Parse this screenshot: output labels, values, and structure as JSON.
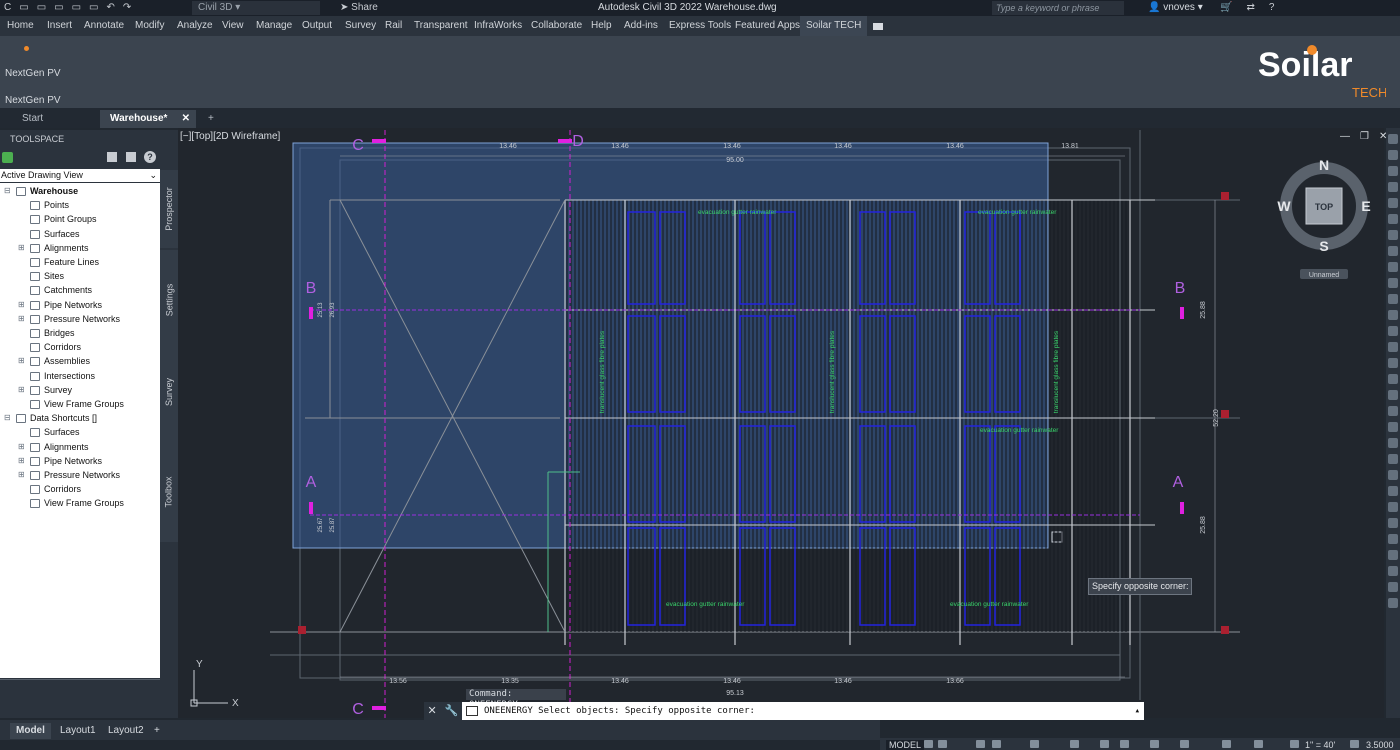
{
  "titlebar": {
    "workspace": "Civil 3D",
    "share": "Share",
    "title": "Autodesk Civil 3D 2022    Warehouse.dwg",
    "search_placeholder": "Type a keyword or phrase",
    "user": "vnoves"
  },
  "menu": [
    "Home",
    "Insert",
    "Annotate",
    "Modify",
    "Analyze",
    "View",
    "Manage",
    "Output",
    "Survey",
    "Rail",
    "Transparent",
    "InfraWorks",
    "Collaborate",
    "Help",
    "Add-ins",
    "Express Tools",
    "Featured Apps",
    "Soilar TECH"
  ],
  "ribbon": {
    "panel_button": "NextGen PV",
    "panel_title": "NextGen PV",
    "logo_main": "Soilar",
    "logo_sub": "TECH"
  },
  "doc_tabs": [
    "Start",
    "Warehouse*"
  ],
  "toolspace": {
    "title": "TOOLSPACE",
    "view_select": "Active Drawing View",
    "tree": [
      "Warehouse",
      "Points",
      "Point Groups",
      "Surfaces",
      "Alignments",
      "Feature Lines",
      "Sites",
      "Catchments",
      "Pipe Networks",
      "Pressure Networks",
      "Bridges",
      "Corridors",
      "Assemblies",
      "Intersections",
      "Survey",
      "View Frame Groups",
      "Data Shortcuts []",
      "Surfaces",
      "Alignments",
      "Pipe Networks",
      "Pressure Networks",
      "Corridors",
      "View Frame Groups"
    ],
    "side_tabs": [
      "Prospector",
      "Settings",
      "Survey",
      "Toolbox"
    ]
  },
  "viewport": {
    "label": "[−][Top][2D Wireframe]",
    "viewcube": {
      "top": "TOP",
      "n": "N",
      "s": "S",
      "e": "E",
      "w": "W",
      "ucs": "Unnamed"
    },
    "dims_top": [
      "13.46",
      "13.46",
      "13.46",
      "13.46",
      "13.46",
      "13.81",
      "95.00"
    ],
    "dims_bottom": [
      "13.56",
      "13.35",
      "13.46",
      "13.46",
      "13.46",
      "13.66",
      "95.13"
    ],
    "dims_right": [
      "25.88",
      "52.20",
      "25.88"
    ],
    "dims_left": [
      "25.13",
      "26.93",
      "25.67",
      "25.87"
    ],
    "grid_letters": [
      "C",
      "D",
      "B",
      "B",
      "A",
      "A",
      "C"
    ],
    "annotations": [
      "evacuation gutter rainwater",
      "evacuation gutter rainwater",
      "evacuation gutter rainwater",
      "evacuation gutter rainwater",
      "evacuation gutter rainwater",
      "translucent glass fibre plates",
      "translucent glass fibre plates",
      "translucent glass fibre plates"
    ],
    "tooltip": "Specify opposite corner:"
  },
  "command": {
    "history": "Command: ONEENERGY",
    "prompt": "ONEENERGY Select objects: Specify opposite corner:"
  },
  "layout_tabs": [
    "Model",
    "Layout1",
    "Layout2"
  ],
  "status": {
    "model": "MODEL",
    "scale": "1\" = 40'",
    "annoscale": "3.5000"
  },
  "colors": {
    "selection": "#3a5f99",
    "accent": "#f08a2a",
    "magenta": "#e020e0",
    "panel_blue": "#2222dd",
    "cad_green": "#39d36a"
  }
}
